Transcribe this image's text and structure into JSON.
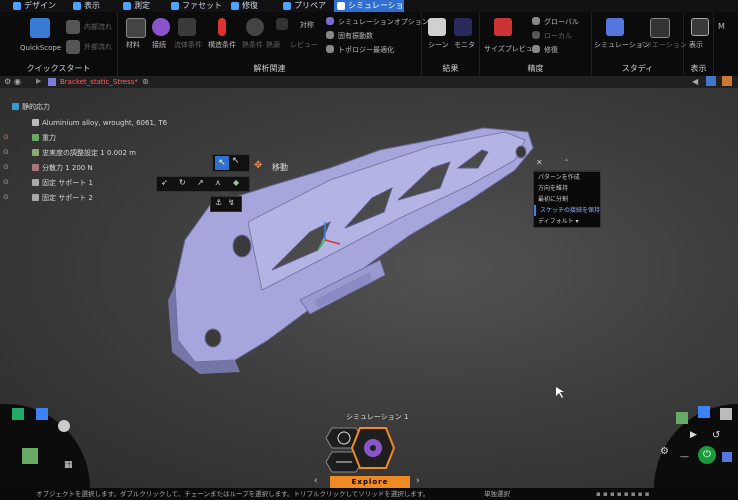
{
  "tabs": [
    {
      "label": "デザイン",
      "active": false
    },
    {
      "label": "表示",
      "active": false
    },
    {
      "label": "測定",
      "active": false
    },
    {
      "label": "ファセット",
      "active": false
    },
    {
      "label": "修復",
      "active": false
    },
    {
      "label": "プリペア",
      "active": false
    },
    {
      "label": "シミュレーション",
      "active": true
    }
  ],
  "ribbon": {
    "groups": [
      {
        "label": "クイックスタート"
      },
      {
        "label": "解析関連"
      },
      {
        "label": "結果"
      },
      {
        "label": "精度"
      },
      {
        "label": "スタディ"
      },
      {
        "label": "表示"
      }
    ],
    "quickscope": "QuickScope",
    "internal_flow": "内部流れ",
    "external_flow": "外部流れ",
    "material": "材料",
    "connection": "接続",
    "fluid_condition": "流体条件",
    "structural_condition": "構造条件",
    "thermal_condition": "熱条件",
    "heat_label": "熱源",
    "symmetry": "対称",
    "review": "レビュー",
    "sim_option": "シミュレーションオプション",
    "natural_freq": "固有振動数",
    "topology_opt": "トポロジー最適化",
    "scene": "シーン",
    "monitor": "モニタ",
    "size_preview": "サイズプレビュー",
    "global": "グローバル",
    "local": "ローカル",
    "repair": "修復",
    "simulation": "シミュレーション",
    "variation": "バリエーション",
    "display": "表示",
    "m_label": "M"
  },
  "breadcrumb": "Bracket_static_Stress*",
  "tree": [
    {
      "label": "静的応力"
    },
    {
      "label": "Aluminium alloy, wrought, 6061, T6"
    },
    {
      "label": "重力"
    },
    {
      "label": "忠実度の調整設定 1     0.002 m"
    },
    {
      "label": "分散力 1     200 N"
    },
    {
      "label": "固定 サポート 1"
    },
    {
      "label": "固定 サポート 2"
    }
  ],
  "move_label": "移動",
  "context_menu": [
    {
      "label": "パターンを作成",
      "selected": false
    },
    {
      "label": "方向を維持",
      "selected": false
    },
    {
      "label": "最初に分割",
      "selected": false
    },
    {
      "label": "スケッチの接続を保持",
      "selected": true
    },
    {
      "label": "ディフォルト",
      "selected": false
    }
  ],
  "simulation_name": "シミュレーション 1",
  "explore_label": "Explore",
  "status_text": "オブジェクトを選択します。ダブルクリックして、チェーンまたはループを選択します。トリプルクリックしてソリッドを選択します。",
  "status_right": "単独選択",
  "colors": {
    "accent": "#2f6fd0",
    "explore": "#f08a24",
    "part": "#9a9ad6",
    "hex_bg": "#1f1f1f"
  }
}
